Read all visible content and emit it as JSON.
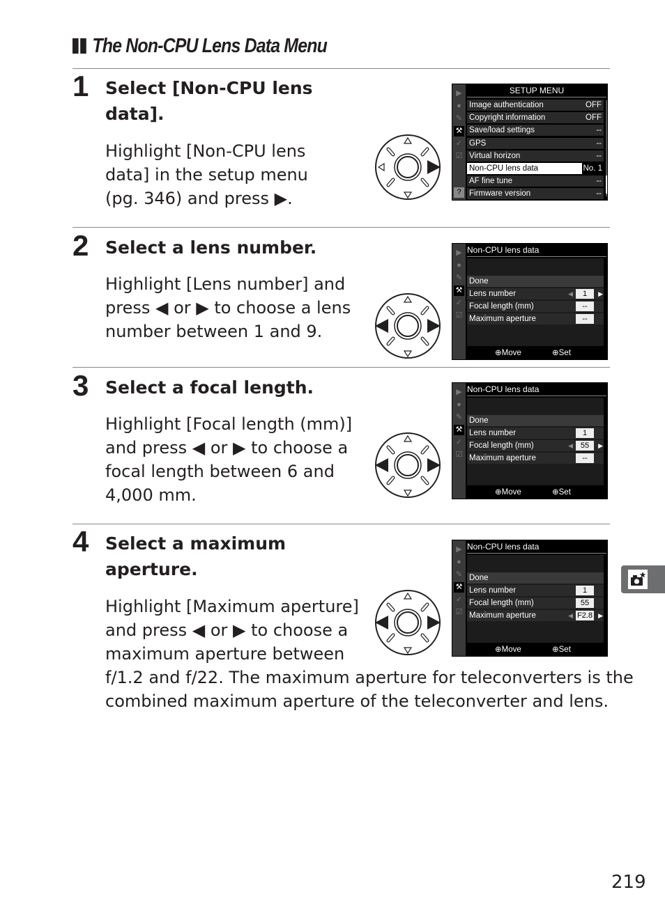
{
  "section": {
    "title": "The Non-CPU Lens Data Menu"
  },
  "steps": [
    {
      "number": "1",
      "title_lines": [
        "Select [Non-CPU lens",
        "data]."
      ],
      "body_lines": [
        "Highlight [Non-CPU lens",
        "data] in the setup menu",
        "(pg. 346) and press ▶."
      ],
      "dial": "right-pressed",
      "screen": {
        "header": "SETUP MENU",
        "rows": [
          {
            "label": "Image authentication",
            "value": "OFF"
          },
          {
            "label": "Copyright information",
            "value": "OFF"
          },
          {
            "label": "Save/load settings",
            "value": "--"
          },
          {
            "label": "GPS",
            "value": "--"
          },
          {
            "label": "Virtual horizon",
            "value": "--"
          },
          {
            "label": "Non-CPU lens data",
            "value": "No. 1",
            "highlighted": true
          },
          {
            "label": "AF fine tune",
            "value": "--"
          },
          {
            "label": "Firmware version",
            "value": "--"
          }
        ]
      }
    },
    {
      "number": "2",
      "title_lines": [
        "Select a lens number."
      ],
      "body_lines": [
        "Highlight [Lens number] and",
        "press ◀ or ▶ to choose a lens",
        "number between 1 and 9."
      ],
      "dial": "left-right-pressed",
      "screen": {
        "header": "Non-CPU lens data",
        "rows": [
          {
            "label": "Done"
          },
          {
            "label": "Lens number",
            "value": "1",
            "active": true
          },
          {
            "label": "Focal length (mm)",
            "value": "--"
          },
          {
            "label": "Maximum aperture",
            "value": "--"
          }
        ],
        "footer_move": "Move",
        "footer_set": "Set"
      }
    },
    {
      "number": "3",
      "title_lines": [
        "Select a focal length."
      ],
      "body_lines": [
        "Highlight [Focal length (mm)]",
        "and press ◀ or ▶ to choose a",
        "focal length between 6 and",
        "4,000 mm."
      ],
      "dial": "left-right-pressed",
      "screen": {
        "header": "Non-CPU lens data",
        "rows": [
          {
            "label": "Done"
          },
          {
            "label": "Lens number",
            "value": "1"
          },
          {
            "label": "Focal length (mm)",
            "value": "55",
            "active": true
          },
          {
            "label": "Maximum aperture",
            "value": "--"
          }
        ],
        "footer_move": "Move",
        "footer_set": "Set"
      }
    },
    {
      "number": "4",
      "title_lines": [
        "Select a maximum",
        "aperture."
      ],
      "body_lines": [
        "Highlight [Maximum aperture]",
        "and press ◀ or ▶ to choose a",
        "maximum aperture between"
      ],
      "body_wide_lines": [
        "f/1.2 and f/22. The maximum aperture for teleconverters is the",
        "combined maximum aperture of the teleconverter and lens."
      ],
      "dial": "left-right-pressed",
      "screen": {
        "header": "Non-CPU lens data",
        "rows": [
          {
            "label": "Done"
          },
          {
            "label": "Lens number",
            "value": "1"
          },
          {
            "label": "Focal length (mm)",
            "value": "55"
          },
          {
            "label": "Maximum aperture",
            "value": "F2.8",
            "active": true
          }
        ],
        "footer_move": "Move",
        "footer_set": "Set"
      }
    }
  ],
  "side_tab": {
    "icon": "camera-star-icon"
  },
  "page_number": "219"
}
